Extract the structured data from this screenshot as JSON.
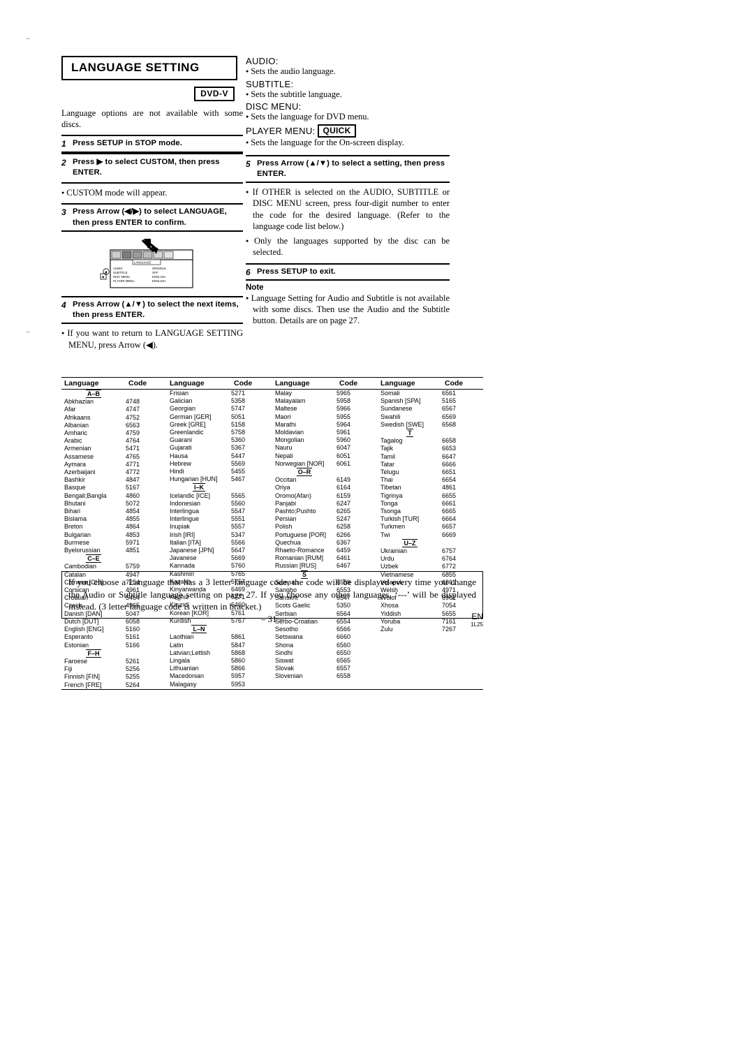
{
  "page": {
    "title": "LANGUAGE SETTING",
    "disc_badge": "DVD-V",
    "lead": "Language options are not available with some discs.",
    "page_number": "– 31 –",
    "region_code": "EN",
    "doc_code": "1L25"
  },
  "left": {
    "steps": [
      {
        "num": "1",
        "text": "Press SETUP in STOP mode."
      },
      {
        "num": "2",
        "text": "Press ▶ to select CUSTOM, then press ENTER."
      },
      {
        "num": "3",
        "text": "Press Arrow (◀/▶) to select LANGUAGE, then press ENTER to confirm."
      },
      {
        "num": "4",
        "text": "Press Arrow (▲/▼) to select the next items, then press ENTER."
      }
    ],
    "bullets": [
      "CUSTOM mode will appear.",
      "If you want to return to LANGUAGE SETTING MENU, press Arrow (◀)."
    ],
    "osd": {
      "rows": [
        {
          "label": "AUDIO",
          "value": "ORIGINAL"
        },
        {
          "label": "SUBTITLE",
          "value": "OFF"
        },
        {
          "label": "DISC MENU",
          "value": "ENGLISH"
        },
        {
          "label": "PLAYER MENU",
          "value": "ENGLISH"
        }
      ],
      "tab": "LANGUAGE"
    }
  },
  "right": {
    "headings": [
      {
        "label": "AUDIO:",
        "desc": "Sets the audio language."
      },
      {
        "label": "SUBTITLE:",
        "desc": "Sets the subtitle language."
      },
      {
        "label": "DISC MENU:",
        "desc": "Sets the language for DVD menu."
      },
      {
        "label": "PLAYER MENU:",
        "badge": "QUICK",
        "desc": "Sets the language for the On-screen display."
      }
    ],
    "steps": [
      {
        "num": "5",
        "text": "Press Arrow (▲/▼) to select a setting, then press ENTER."
      },
      {
        "num": "6",
        "text": "Press SETUP to exit."
      }
    ],
    "bullets": [
      "If OTHER is selected on the AUDIO, SUBTITLE or DISC MENU screen, press four-digit number to enter the code for the desired language. (Refer to the language code list below.)",
      "Only the languages supported by the disc can be selected."
    ],
    "note_title": "Note",
    "note_bullets": [
      "Language Setting for Audio and Subtitle is not available with some discs. Then use the Audio and the Subtitle button. Details are on page 27."
    ]
  },
  "bottom_note": "If you choose a Language that has a 3 letter language code, the code will be displayed every time you change the Audio or Subtitle language setting on page 27. If you choose any other languages, ‘---’ will be displayed instead. (3 letter language code is written in bracket.)",
  "code_table": {
    "headers": {
      "language": "Language",
      "code": "Code"
    },
    "columns": [
      [
        {
          "sep": "A–B"
        },
        {
          "l": "Abkhazian",
          "c": "4748"
        },
        {
          "l": "Afar",
          "c": "4747"
        },
        {
          "l": "Afrikaans",
          "c": "4752"
        },
        {
          "l": "Albanian",
          "c": "6563"
        },
        {
          "l": "Amharic",
          "c": "4759"
        },
        {
          "l": "Arabic",
          "c": "4764"
        },
        {
          "l": "Armenian",
          "c": "5471"
        },
        {
          "l": "Assamese",
          "c": "4765"
        },
        {
          "l": "Aymara",
          "c": "4771"
        },
        {
          "l": "Azerbaijani",
          "c": "4772"
        },
        {
          "l": "Bashkir",
          "c": "4847"
        },
        {
          "l": "Basque",
          "c": "5167"
        },
        {
          "l": "Bengali;Bangla",
          "c": "4860"
        },
        {
          "l": "Bhutani",
          "c": "5072"
        },
        {
          "l": "Bihari",
          "c": "4854"
        },
        {
          "l": "Bislama",
          "c": "4855"
        },
        {
          "l": "Breton",
          "c": "4864"
        },
        {
          "l": "Bulgarian",
          "c": "4853"
        },
        {
          "l": "Burmese",
          "c": "5971"
        },
        {
          "l": "Byelorussian",
          "c": "4851"
        },
        {
          "sep": "C–E"
        },
        {
          "l": "Cambodian",
          "c": "5759"
        },
        {
          "l": "Catalan",
          "c": "4947"
        },
        {
          "l": "Chinese [CHI]",
          "c": "7254"
        },
        {
          "l": "Corsican",
          "c": "4961"
        },
        {
          "l": "Croatian",
          "c": "5464"
        },
        {
          "l": "Czech",
          "c": "4965"
        },
        {
          "l": "Danish [DAN]",
          "c": "5047"
        },
        {
          "l": "Dutch [DUT]",
          "c": "6058"
        },
        {
          "l": "English [ENG]",
          "c": "5160"
        },
        {
          "l": "Esperanto",
          "c": "5161"
        },
        {
          "l": "Estonian",
          "c": "5166"
        },
        {
          "sep": "F–H"
        },
        {
          "l": "Faroese",
          "c": "5261"
        },
        {
          "l": "Fiji",
          "c": "5256"
        },
        {
          "l": "Finnish [FIN]",
          "c": "5255"
        },
        {
          "l": "French [FRE]",
          "c": "5264"
        }
      ],
      [
        {
          "l": "Frisian",
          "c": "5271"
        },
        {
          "l": "Galician",
          "c": "5358"
        },
        {
          "l": "Georgian",
          "c": "5747"
        },
        {
          "l": "German [GER]",
          "c": "5051"
        },
        {
          "l": "Greek [GRE]",
          "c": "5158"
        },
        {
          "l": "Greenlandic",
          "c": "5758"
        },
        {
          "l": "Guarani",
          "c": "5360"
        },
        {
          "l": "Gujarati",
          "c": "5367"
        },
        {
          "l": "Hausa",
          "c": "5447"
        },
        {
          "l": "Hebrew",
          "c": "5569"
        },
        {
          "l": "Hindi",
          "c": "5455"
        },
        {
          "l": "Hungarian [HUN]",
          "c": "5467"
        },
        {
          "sep": "I–K"
        },
        {
          "l": "Icelandic [ICE]",
          "c": "5565"
        },
        {
          "l": "Indonesian",
          "c": "5560"
        },
        {
          "l": "Interlingua",
          "c": "5547"
        },
        {
          "l": "Interlingue",
          "c": "5551"
        },
        {
          "l": "Inupiak",
          "c": "5557"
        },
        {
          "l": "Irish [IRI]",
          "c": "5347"
        },
        {
          "l": "Italian [ITA]",
          "c": "5566"
        },
        {
          "l": "Japanese [JPN]",
          "c": "5647"
        },
        {
          "l": "Javanese",
          "c": "5669"
        },
        {
          "l": "Kannada",
          "c": "5760"
        },
        {
          "l": "Kashmiri",
          "c": "5765"
        },
        {
          "l": "Kazakh",
          "c": "5757"
        },
        {
          "l": "Kinyarwanda",
          "c": "6469"
        },
        {
          "l": "Kirghiz",
          "c": "5771"
        },
        {
          "l": "Kirundi",
          "c": "6460"
        },
        {
          "l": "Korean [KOR]",
          "c": "5761"
        },
        {
          "l": "Kurdish",
          "c": "5767"
        },
        {
          "sep": "L–N"
        },
        {
          "l": "Laothian",
          "c": "5861"
        },
        {
          "l": "Latin",
          "c": "5847"
        },
        {
          "l": "Latvian;Lettish",
          "c": "5868"
        },
        {
          "l": "Lingala",
          "c": "5860"
        },
        {
          "l": "Lithuanian",
          "c": "5866"
        },
        {
          "l": "Macedonian",
          "c": "5957"
        },
        {
          "l": "Malagasy",
          "c": "5953"
        }
      ],
      [
        {
          "l": "Malay",
          "c": "5965"
        },
        {
          "l": "Malayalam",
          "c": "5958"
        },
        {
          "l": "Maltese",
          "c": "5966"
        },
        {
          "l": "Maori",
          "c": "5955"
        },
        {
          "l": "Marathi",
          "c": "5964"
        },
        {
          "l": "Moldavian",
          "c": "5961"
        },
        {
          "l": "Mongolian",
          "c": "5960"
        },
        {
          "l": "Nauru",
          "c": "6047"
        },
        {
          "l": "Nepali",
          "c": "6051"
        },
        {
          "l": "Norwegian [NOR]",
          "c": "6061"
        },
        {
          "sep": "O–R"
        },
        {
          "l": "Occitan",
          "c": "6149"
        },
        {
          "l": "Oriya",
          "c": "6164"
        },
        {
          "l": "Oromo(Afan)",
          "c": "6159"
        },
        {
          "l": "Panjabi",
          "c": "6247"
        },
        {
          "l": "Pashto;Pushto",
          "c": "6265"
        },
        {
          "l": "Persian",
          "c": "5247"
        },
        {
          "l": "Polish",
          "c": "6258"
        },
        {
          "l": "Portuguese [POR]",
          "c": "6266"
        },
        {
          "l": "Quechua",
          "c": "6367"
        },
        {
          "l": "Rhaeto-Romance",
          "c": "6459"
        },
        {
          "l": "Romanian [RUM]",
          "c": "6461"
        },
        {
          "l": "Russian [RUS]",
          "c": "6467"
        },
        {
          "sep": "S"
        },
        {
          "l": "Samoan",
          "c": "6559"
        },
        {
          "l": "Sangho",
          "c": "6553"
        },
        {
          "l": "Sanskrit",
          "c": "6547"
        },
        {
          "l": "Scots Gaelic",
          "c": "5350"
        },
        {
          "l": "Serbian",
          "c": "6564"
        },
        {
          "l": "Serbo-Croatian",
          "c": "6554"
        },
        {
          "l": "Sesotho",
          "c": "6566"
        },
        {
          "l": "Setswana",
          "c": "6660"
        },
        {
          "l": "Shona",
          "c": "6560"
        },
        {
          "l": "Sindhi",
          "c": "6550"
        },
        {
          "l": "Siswat",
          "c": "6565"
        },
        {
          "l": "Slovak",
          "c": "6557"
        },
        {
          "l": "Slovenian",
          "c": "6558"
        }
      ],
      [
        {
          "l": "Somali",
          "c": "6561"
        },
        {
          "l": "Spanish [SPA]",
          "c": "5165"
        },
        {
          "l": "Sundanese",
          "c": "6567"
        },
        {
          "l": "Swahili",
          "c": "6569"
        },
        {
          "l": "Swedish [SWE]",
          "c": "6568"
        },
        {
          "sep": "T"
        },
        {
          "l": "Tagalog",
          "c": "6658"
        },
        {
          "l": "Tajik",
          "c": "6653"
        },
        {
          "l": "Tamil",
          "c": "6647"
        },
        {
          "l": "Tatar",
          "c": "6666"
        },
        {
          "l": "Telugu",
          "c": "6651"
        },
        {
          "l": "Thai",
          "c": "6654"
        },
        {
          "l": "Tibetan",
          "c": "4861"
        },
        {
          "l": "Tigrinya",
          "c": "6655"
        },
        {
          "l": "Tonga",
          "c": "6661"
        },
        {
          "l": "Tsonga",
          "c": "6665"
        },
        {
          "l": "Turkish [TUR]",
          "c": "6664"
        },
        {
          "l": "Turkmen",
          "c": "6657"
        },
        {
          "l": "Twi",
          "c": "6669"
        },
        {
          "sep": "U–Z"
        },
        {
          "l": "Ukrainian",
          "c": "6757"
        },
        {
          "l": "Urdu",
          "c": "6764"
        },
        {
          "l": "Uzbek",
          "c": "6772"
        },
        {
          "l": "Vietnamese",
          "c": "6855"
        },
        {
          "l": "Volapuk",
          "c": "6861"
        },
        {
          "l": "Welsh",
          "c": "4971"
        },
        {
          "l": "Wolof",
          "c": "6961"
        },
        {
          "l": "Xhosa",
          "c": "7054"
        },
        {
          "l": "Yiddish",
          "c": "5655"
        },
        {
          "l": "Yoruba",
          "c": "7161"
        },
        {
          "l": "Zulu",
          "c": "7267"
        }
      ]
    ]
  }
}
